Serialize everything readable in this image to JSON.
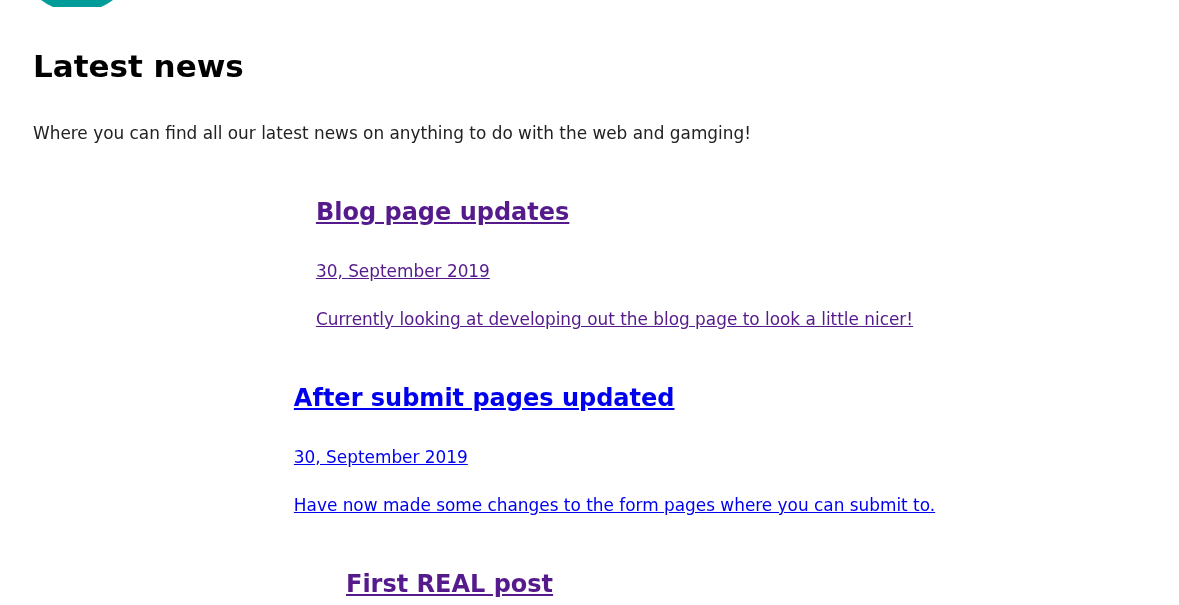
{
  "page": {
    "heading": "Latest news",
    "intro": "Where you can find all our latest news on anything to do with the web and gamging!"
  },
  "posts": [
    {
      "title": "Blog page updates",
      "date": "30, September 2019",
      "summary": "Currently looking at developing out the blog page to look a little nicer!",
      "visited": true
    },
    {
      "title": "After submit pages updated",
      "date": "30, September 2019",
      "summary": "Have now made some changes to the form pages where you can submit to.",
      "visited": false
    },
    {
      "title": "First REAL post",
      "visited": true
    }
  ]
}
